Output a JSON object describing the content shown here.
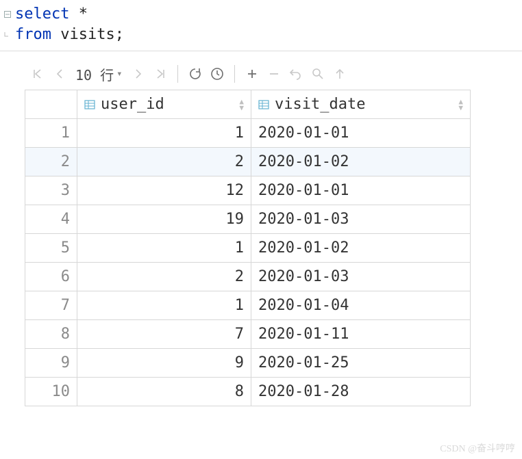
{
  "sql": {
    "line1_kw": "select",
    "line1_rest": " *",
    "line2_kw": "from",
    "line2_rest": " visits;"
  },
  "toolbar": {
    "page_size_label": "10 行"
  },
  "columns": {
    "user_id": "user_id",
    "visit_date": "visit_date"
  },
  "chart_data": {
    "type": "table",
    "columns": [
      "user_id",
      "visit_date"
    ],
    "rows": [
      {
        "n": "1",
        "user_id": "1",
        "visit_date": "2020-01-01"
      },
      {
        "n": "2",
        "user_id": "2",
        "visit_date": "2020-01-02"
      },
      {
        "n": "3",
        "user_id": "12",
        "visit_date": "2020-01-01"
      },
      {
        "n": "4",
        "user_id": "19",
        "visit_date": "2020-01-03"
      },
      {
        "n": "5",
        "user_id": "1",
        "visit_date": "2020-01-02"
      },
      {
        "n": "6",
        "user_id": "2",
        "visit_date": "2020-01-03"
      },
      {
        "n": "7",
        "user_id": "1",
        "visit_date": "2020-01-04"
      },
      {
        "n": "8",
        "user_id": "7",
        "visit_date": "2020-01-11"
      },
      {
        "n": "9",
        "user_id": "9",
        "visit_date": "2020-01-25"
      },
      {
        "n": "10",
        "user_id": "8",
        "visit_date": "2020-01-28"
      }
    ]
  },
  "watermark": "CSDN @奋斗哼哼"
}
